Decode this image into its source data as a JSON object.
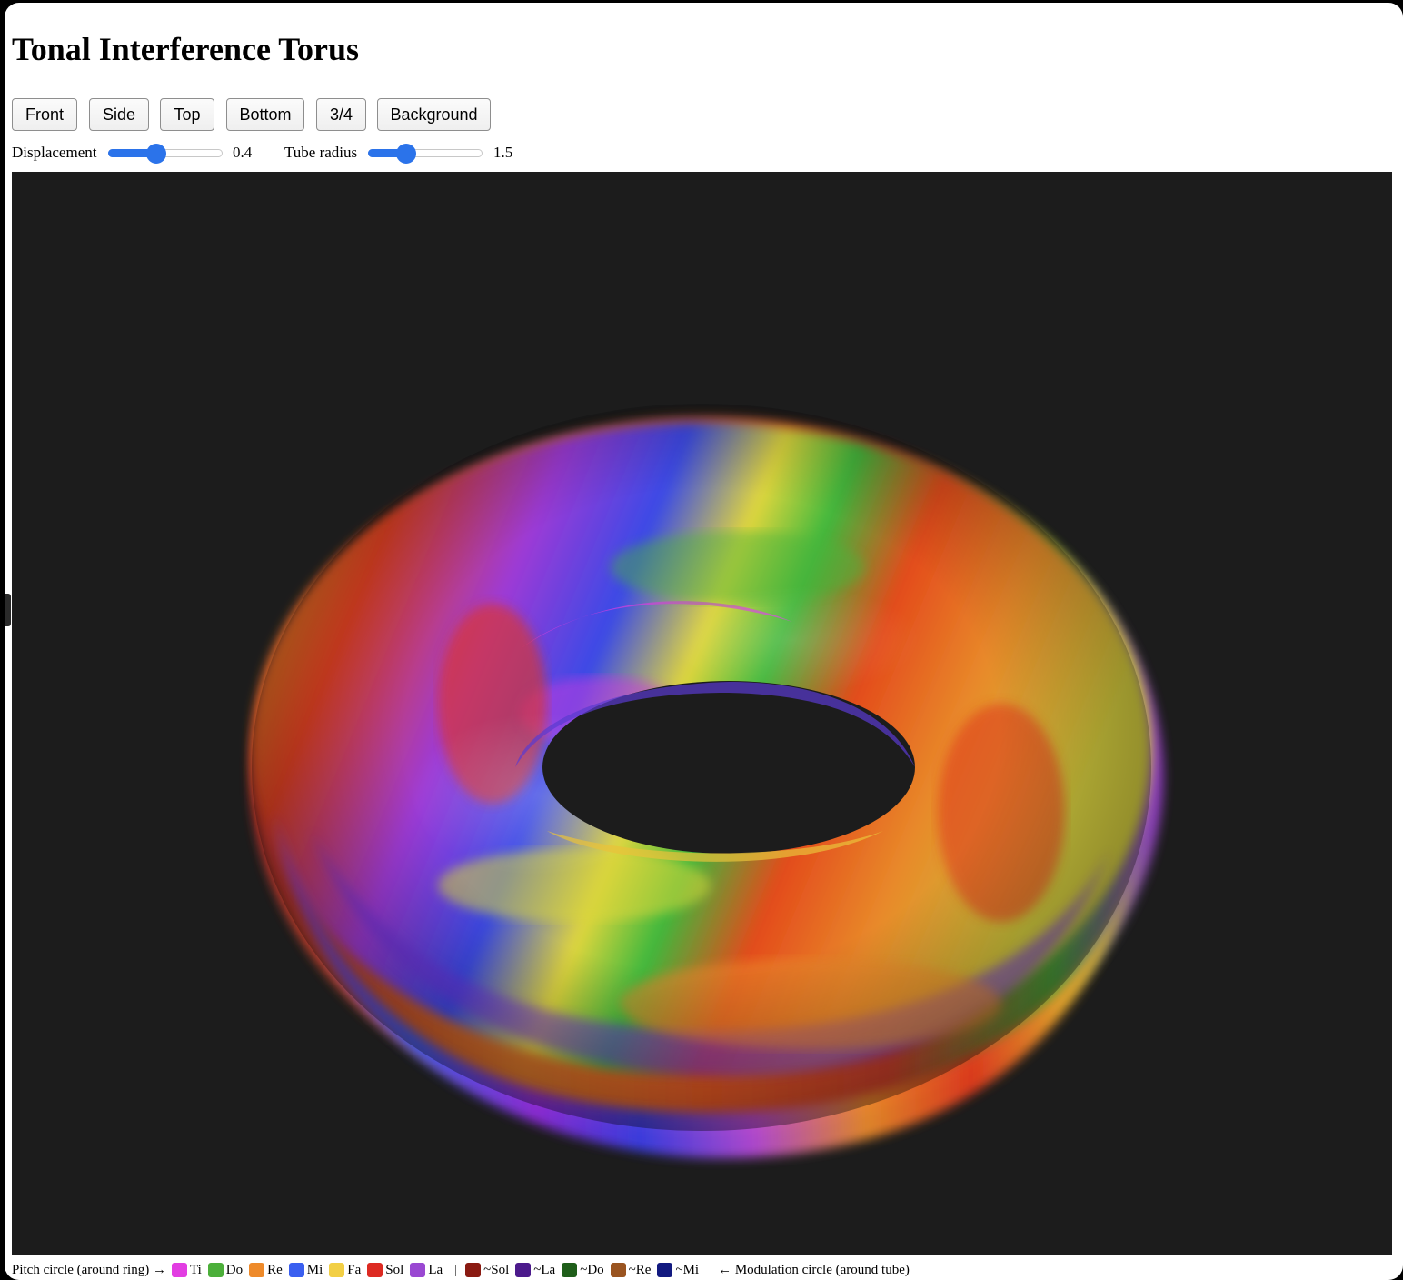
{
  "title": "Tonal Interference Torus",
  "view_buttons": [
    "Front",
    "Side",
    "Top",
    "Bottom",
    "3/4",
    "Background"
  ],
  "controls": {
    "displacement": {
      "label": "Displacement",
      "value": "0.4",
      "fraction": 0.42
    },
    "tube_radius": {
      "label": "Tube radius",
      "value": "1.5",
      "fraction": 0.33
    }
  },
  "viewport": {
    "background": "#1c1c1c"
  },
  "legend": {
    "start_label": "Pitch circle (around ring) →",
    "pitch": [
      {
        "label": "Ti",
        "color": "#e23de2"
      },
      {
        "label": "Do",
        "color": "#4caf3a"
      },
      {
        "label": "Re",
        "color": "#ee8a2a"
      },
      {
        "label": "Mi",
        "color": "#3a5ff0"
      },
      {
        "label": "Fa",
        "color": "#f2cf45"
      },
      {
        "label": "Sol",
        "color": "#dd2a22"
      },
      {
        "label": "La",
        "color": "#9a48d2"
      }
    ],
    "separator": "|",
    "modulation": [
      {
        "label": "~Sol",
        "color": "#8a1a12"
      },
      {
        "label": "~La",
        "color": "#4c1a8c"
      },
      {
        "label": "~Do",
        "color": "#1f5e1a"
      },
      {
        "label": "~Re",
        "color": "#9a5420"
      },
      {
        "label": "~Mi",
        "color": "#121a80"
      }
    ],
    "end_label": "← Modulation circle (around tube)"
  }
}
